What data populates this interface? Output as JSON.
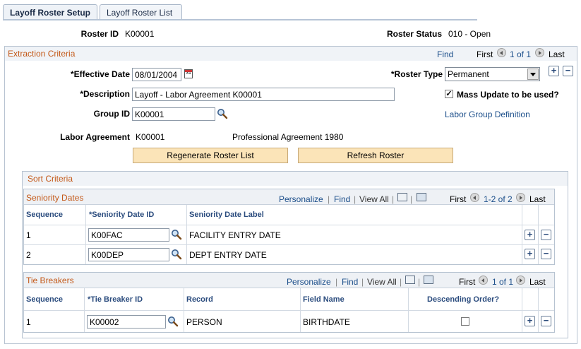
{
  "tabs": [
    {
      "label": "Layoff Roster Setup",
      "active": true
    },
    {
      "label": "Layoff Roster List",
      "active": false
    }
  ],
  "roster": {
    "id_label": "Roster ID",
    "id_value": "K00001",
    "status_label": "Roster Status",
    "status_value": "010 - Open"
  },
  "extraction": {
    "title": "Extraction Criteria",
    "find": "Find",
    "first": "First",
    "count": "1 of 1",
    "last": "Last",
    "effective_date_label": "*Effective Date",
    "effective_date_value": "08/01/2004",
    "roster_type_label": "*Roster Type",
    "roster_type_value": "Permanent",
    "description_label": "*Description",
    "description_value": "Layoff - Labor Agreement K00001",
    "mass_update_label": "Mass Update to be used?",
    "mass_update_checked": true,
    "group_id_label": "Group ID",
    "group_id_value": "K00001",
    "labor_group_link": "Labor Group Definition",
    "labor_agreement_label": "Labor Agreement",
    "labor_agreement_value": "K00001",
    "labor_agreement_desc": "Professional Agreement 1980",
    "regenerate_button": "Regenerate Roster List",
    "refresh_button": "Refresh Roster"
  },
  "sort_criteria": {
    "title": "Sort Criteria"
  },
  "seniority": {
    "title": "Seniority Dates",
    "personalize": "Personalize",
    "find": "Find",
    "view_all": "View All",
    "first": "First",
    "count": "1-2 of 2",
    "last": "Last",
    "columns": [
      "Sequence",
      "*Seniority Date ID",
      "Seniority Date Label"
    ],
    "rows": [
      {
        "sequence": "1",
        "id": "K00FAC",
        "label": "FACILITY ENTRY DATE"
      },
      {
        "sequence": "2",
        "id": "K00DEP",
        "label": "DEPT ENTRY DATE"
      }
    ]
  },
  "tiebreakers": {
    "title": "Tie Breakers",
    "personalize": "Personalize",
    "find": "Find",
    "view_all": "View All",
    "first": "First",
    "count": "1 of 1",
    "last": "Last",
    "columns": [
      "Sequence",
      "*Tie Breaker ID",
      "Record",
      "Field Name",
      "Descending Order?"
    ],
    "rows": [
      {
        "sequence": "1",
        "id": "K00002",
        "record": "PERSON",
        "field": "BIRTHDATE",
        "descending": false
      }
    ]
  },
  "icons": {
    "lookup": "magnifier-icon",
    "calendar": "calendar-icon",
    "add": "plus-icon",
    "remove": "minus-icon",
    "zoom": "zoom-grid-icon",
    "download": "download-grid-icon"
  }
}
